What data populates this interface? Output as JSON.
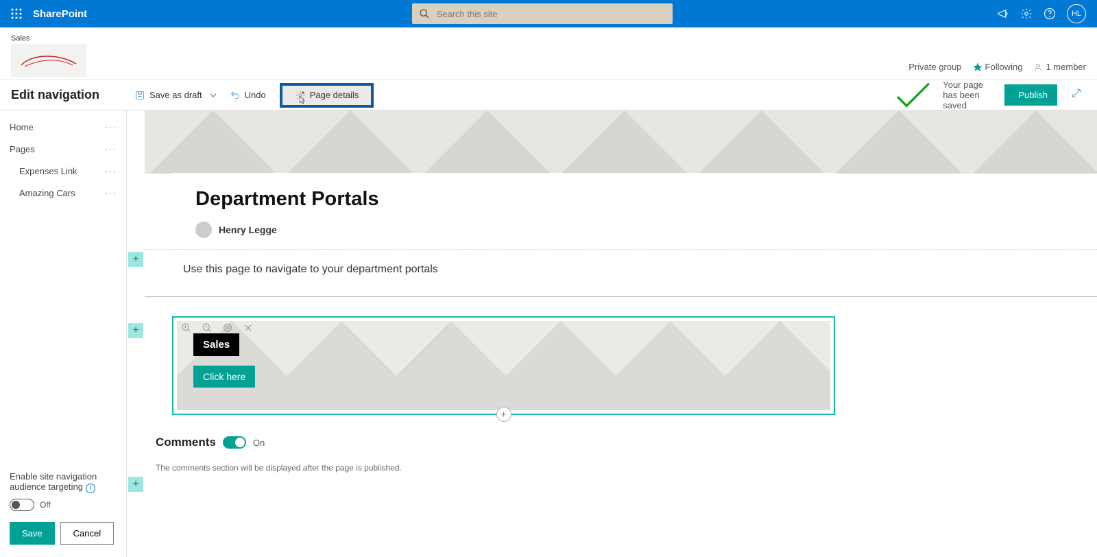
{
  "suite": {
    "brand": "SharePoint",
    "search_placeholder": "Search this site",
    "avatar_initials": "HL"
  },
  "site": {
    "name": "Sales",
    "privacy": "Private group",
    "following": "Following",
    "members": "1 member"
  },
  "toolbar": {
    "save_as_draft": "Save as draft",
    "undo": "Undo",
    "page_details": "Page details",
    "saved_msg": "Your page has been saved",
    "publish": "Publish"
  },
  "sidebar": {
    "title": "Edit navigation",
    "items": [
      {
        "label": "Home"
      },
      {
        "label": "Pages"
      },
      {
        "label": "Expenses Link"
      },
      {
        "label": "Amazing Cars"
      }
    ],
    "audience_targeting_label": "Enable site navigation audience targeting",
    "off": "Off",
    "save": "Save",
    "cancel": "Cancel"
  },
  "page": {
    "title": "Department Portals",
    "author": "Henry Legge",
    "intro": "Use this page to navigate to your department portals"
  },
  "webpart": {
    "title": "Sales",
    "cta": "Click here"
  },
  "comments": {
    "heading": "Comments",
    "state": "On",
    "note": "The comments section will be displayed after the page is published."
  }
}
